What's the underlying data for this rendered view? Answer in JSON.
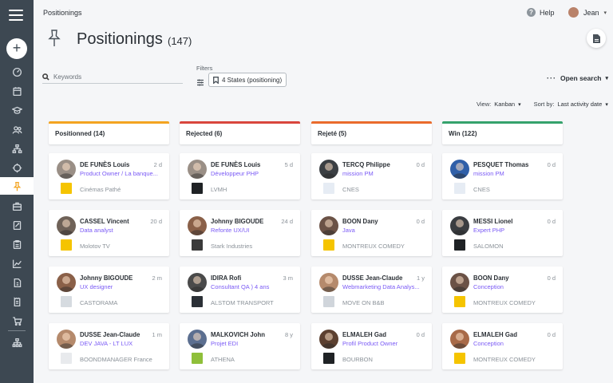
{
  "breadcrumb": "Positionings",
  "topbar": {
    "help_label": "Help",
    "user_name": "Jean"
  },
  "header": {
    "title": "Positionings",
    "count": "(147)"
  },
  "search": {
    "placeholder": "Keywords"
  },
  "filters": {
    "label": "Filters",
    "state_chip": "4 States (positioning)"
  },
  "open_search": {
    "dots": "···",
    "label": "Open search",
    "caret": "▾"
  },
  "viewsort": {
    "view_label": "View:",
    "view_value": "Kanban",
    "sort_label": "Sort by:",
    "sort_value": "Last activity date",
    "caret": "▾"
  },
  "sidebar": {
    "add_label": "+",
    "items": [
      {
        "name": "dashboard-icon"
      },
      {
        "name": "calendar-icon"
      },
      {
        "name": "academic-icon"
      },
      {
        "name": "people-icon"
      },
      {
        "name": "org-chart-icon"
      },
      {
        "name": "target-icon"
      },
      {
        "name": "pin-icon",
        "active": true
      },
      {
        "name": "briefcase-icon"
      },
      {
        "name": "document-icon"
      },
      {
        "name": "clipboard-icon"
      },
      {
        "name": "chart-icon"
      },
      {
        "name": "invoice-icon"
      },
      {
        "name": "receipt-icon"
      },
      {
        "name": "cart-icon"
      },
      {
        "name": "settings-tree-icon"
      }
    ]
  },
  "colors": {
    "accent": "#f3a421",
    "positionned": "#f3a421",
    "rejected": "#d9463d",
    "rejete": "#ea6b2c",
    "win": "#35a26c",
    "role": "#7a5af5",
    "sidebar": "#3d4852"
  },
  "columns": [
    {
      "header": "Positionned (14)",
      "color": "#f3a421",
      "cards": [
        {
          "name": "DE FUNÈS Louis",
          "role": "Product Owner / La banque...",
          "age": "2 d",
          "company": "Cinémas Pathé",
          "logo_color": "#f5c400",
          "avatar_color": "#9a8f86"
        },
        {
          "name": "CASSEL Vincent",
          "role": "Data analyst",
          "age": "20 d",
          "company": "Molotov TV",
          "logo_color": "#f5c400",
          "avatar_color": "#6f6258"
        },
        {
          "name": "Johnny BIGOUDE",
          "role": "UX designer",
          "age": "2 m",
          "company": "CASTORAMA",
          "logo_color": "#d6dbe0",
          "avatar_color": "#8a6048"
        },
        {
          "name": "DUSSE Jean-Claude",
          "role": "DEV JAVA - LT LUX",
          "age": "1 m",
          "company": "BOONDMANAGER France",
          "logo_color": "#e8eaed",
          "avatar_color": "#b58a6c"
        }
      ]
    },
    {
      "header": "Rejected (6)",
      "color": "#d9463d",
      "cards": [
        {
          "name": "DE FUNÈS Louis",
          "role": "Développeur PHP",
          "age": "5 d",
          "company": "LVMH",
          "logo_color": "#1f2225",
          "avatar_color": "#9a8f86"
        },
        {
          "name": "Johnny BIGOUDE",
          "role": "Refonte UX/UI",
          "age": "24 d",
          "company": "Stark Industries",
          "logo_color": "#3a3a3a",
          "avatar_color": "#8a6048"
        },
        {
          "name": "IDIRA Rofi",
          "role": "Consultant QA ) 4 ans",
          "age": "3 m",
          "company": "ALSTOM TRANSPORT",
          "logo_color": "#2b3036",
          "avatar_color": "#4a4a4a"
        },
        {
          "name": "MALKOVICH John",
          "role": "Projet EDI",
          "age": "8 y",
          "company": "ATHENA",
          "logo_color": "#8fbf3a",
          "avatar_color": "#5c6f90"
        }
      ]
    },
    {
      "header": "Rejeté (5)",
      "color": "#ea6b2c",
      "cards": [
        {
          "name": "TERCQ Philippe",
          "role": "mission PM",
          "age": "0 d",
          "company": "CNES",
          "logo_color": "#e6ecf4",
          "avatar_color": "#3b3f43"
        },
        {
          "name": "BOON Dany",
          "role": "Java",
          "age": "0 d",
          "company": "MONTREUX COMEDY",
          "logo_color": "#f5c400",
          "avatar_color": "#6b5246"
        },
        {
          "name": "DUSSE Jean-Claude",
          "role": "Webmarketing Data Analys...",
          "age": "1 y",
          "company": "MOVE ON B&B",
          "logo_color": "#d0d5db",
          "avatar_color": "#b58a6c"
        },
        {
          "name": "ELMALEH Gad",
          "role": "Profil Product Owner",
          "age": "0 d",
          "company": "BOURBON",
          "logo_color": "#1f2225",
          "avatar_color": "#5c4030"
        }
      ]
    },
    {
      "header": "Win (122)",
      "color": "#35a26c",
      "cards": [
        {
          "name": "PESQUET Thomas",
          "role": "mission PM",
          "age": "0 d",
          "company": "CNES",
          "logo_color": "#e6ecf4",
          "avatar_color": "#2f5fa8"
        },
        {
          "name": "MESSI Lionel",
          "role": "Expert PHP",
          "age": "0 d",
          "company": "SALOMON",
          "logo_color": "#1f2225",
          "avatar_color": "#3a3d41"
        },
        {
          "name": "BOON Dany",
          "role": "Conception",
          "age": "0 d",
          "company": "MONTREUX COMEDY",
          "logo_color": "#f5c400",
          "avatar_color": "#6b5246"
        },
        {
          "name": "ELMALEH Gad",
          "role": "Conception",
          "age": "0 d",
          "company": "MONTREUX COMEDY",
          "logo_color": "#f5c400",
          "avatar_color": "#a86a48"
        }
      ]
    }
  ]
}
